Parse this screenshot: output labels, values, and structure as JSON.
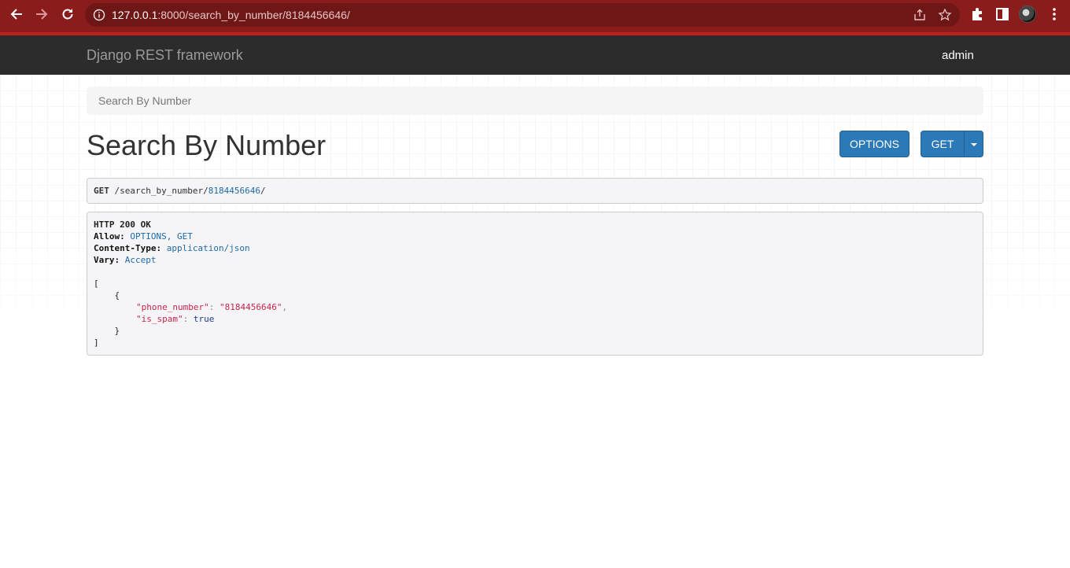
{
  "browser": {
    "url_host": "127.0.0.1",
    "url_path": ":8000/search_by_number/8184456646/"
  },
  "navbar": {
    "brand": "Django REST framework",
    "user": "admin"
  },
  "breadcrumb": "Search By Number",
  "page_title": "Search By Number",
  "buttons": {
    "options": "OPTIONS",
    "get": "GET"
  },
  "request": {
    "method": "GET",
    "path_prefix": " /search_by_number/",
    "path_value": "8184456646",
    "path_suffix": "/"
  },
  "response": {
    "status": "HTTP 200 OK",
    "allow_key": "Allow:",
    "allow_val": "OPTIONS, GET",
    "ctype_key": "Content-Type:",
    "ctype_val": "application/json",
    "vary_key": "Vary:",
    "vary_val": "Accept",
    "open_bracket": "[",
    "open_brace": "    {",
    "phone_key": "\"phone_number\"",
    "phone_val": "\"8184456646\"",
    "spam_key": "\"is_spam\"",
    "spam_val": "true",
    "close_brace": "    }",
    "close_bracket": "]"
  },
  "colors": {
    "chrome": "#8b1c1c",
    "navbar": "#2c2c2c",
    "button": "#2c79b8"
  }
}
